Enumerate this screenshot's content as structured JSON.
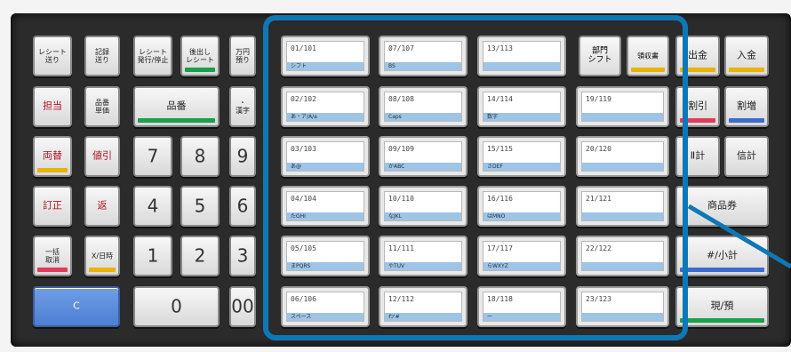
{
  "left": {
    "receipt_feed": "レシート\n送り",
    "journal_feed": "記録\n送り",
    "receipt_onoff": "レシート\n発行/停止",
    "reissue_receipt": "後出し\nレシート",
    "currency_deposit": "万円\n預り",
    "clerk": "担当",
    "item_price": "品番\n単価",
    "item_number": "品番",
    "kanji": "・\n漢字",
    "exchange": "両替",
    "discount": "値引",
    "correction": "訂正",
    "return": "返",
    "bulk_cancel": "一括\n取消",
    "x_datetime": "X/日時"
  },
  "keypad": {
    "k7": "7",
    "k8": "8",
    "k9": "9",
    "k4": "4",
    "k5": "5",
    "k6": "6",
    "k1": "1",
    "k2": "2",
    "k3": "3",
    "k0": "0",
    "k00": "00",
    "clear": "C"
  },
  "plu": {
    "rows": [
      [
        {
          "code": "01/101",
          "sub": "シフト"
        },
        {
          "code": "07/107",
          "sub": "BS"
        },
        {
          "code": "13/113",
          "sub": ""
        }
      ],
      [
        {
          "code": "02/102",
          "sub": "あ・ア/A/a"
        },
        {
          "code": "08/108",
          "sub": "Caps"
        },
        {
          "code": "14/114",
          "sub": "数字"
        },
        {
          "code": "19/119",
          "sub": ""
        }
      ],
      [
        {
          "code": "03/103",
          "sub": "あ@"
        },
        {
          "code": "09/109",
          "sub": "かABC"
        },
        {
          "code": "15/115",
          "sub": "さDEF"
        },
        {
          "code": "20/120",
          "sub": ""
        }
      ],
      [
        {
          "code": "04/104",
          "sub": "たGHI"
        },
        {
          "code": "10/110",
          "sub": "なJKL"
        },
        {
          "code": "16/116",
          "sub": "はMNO"
        },
        {
          "code": "21/121",
          "sub": ""
        }
      ],
      [
        {
          "code": "05/105",
          "sub": "まPQRS"
        },
        {
          "code": "11/111",
          "sub": "やTUV"
        },
        {
          "code": "17/117",
          "sub": "らWXYZ"
        },
        {
          "code": "22/122",
          "sub": ""
        }
      ],
      [
        {
          "code": "06/106",
          "sub": "スペース"
        },
        {
          "code": "12/112",
          "sub": "わ'#"
        },
        {
          "code": "18/118",
          "sub": "ー"
        },
        {
          "code": "23/123",
          "sub": ""
        }
      ]
    ]
  },
  "right": {
    "department_shift": "部門\nシフト",
    "receipt_slip": "領収書",
    "paid_out": "出金",
    "received": "入金",
    "pct_discount": "割引",
    "pct_surcharge": "割増",
    "subtotal2": "Ⅱ計",
    "credit": "信計",
    "gift_certificate": "商品券",
    "subtotal": "#/小計",
    "cash": "現/預"
  },
  "colors": {
    "highlight": "#0e78b7",
    "clear_key": "#4c7fd3",
    "bar_green": "#18a04a",
    "bar_yellow": "#e8b400",
    "bar_pink": "#e23a5a",
    "bar_blue": "#3a6cd0",
    "plu_strip": "#9ec4e6"
  }
}
